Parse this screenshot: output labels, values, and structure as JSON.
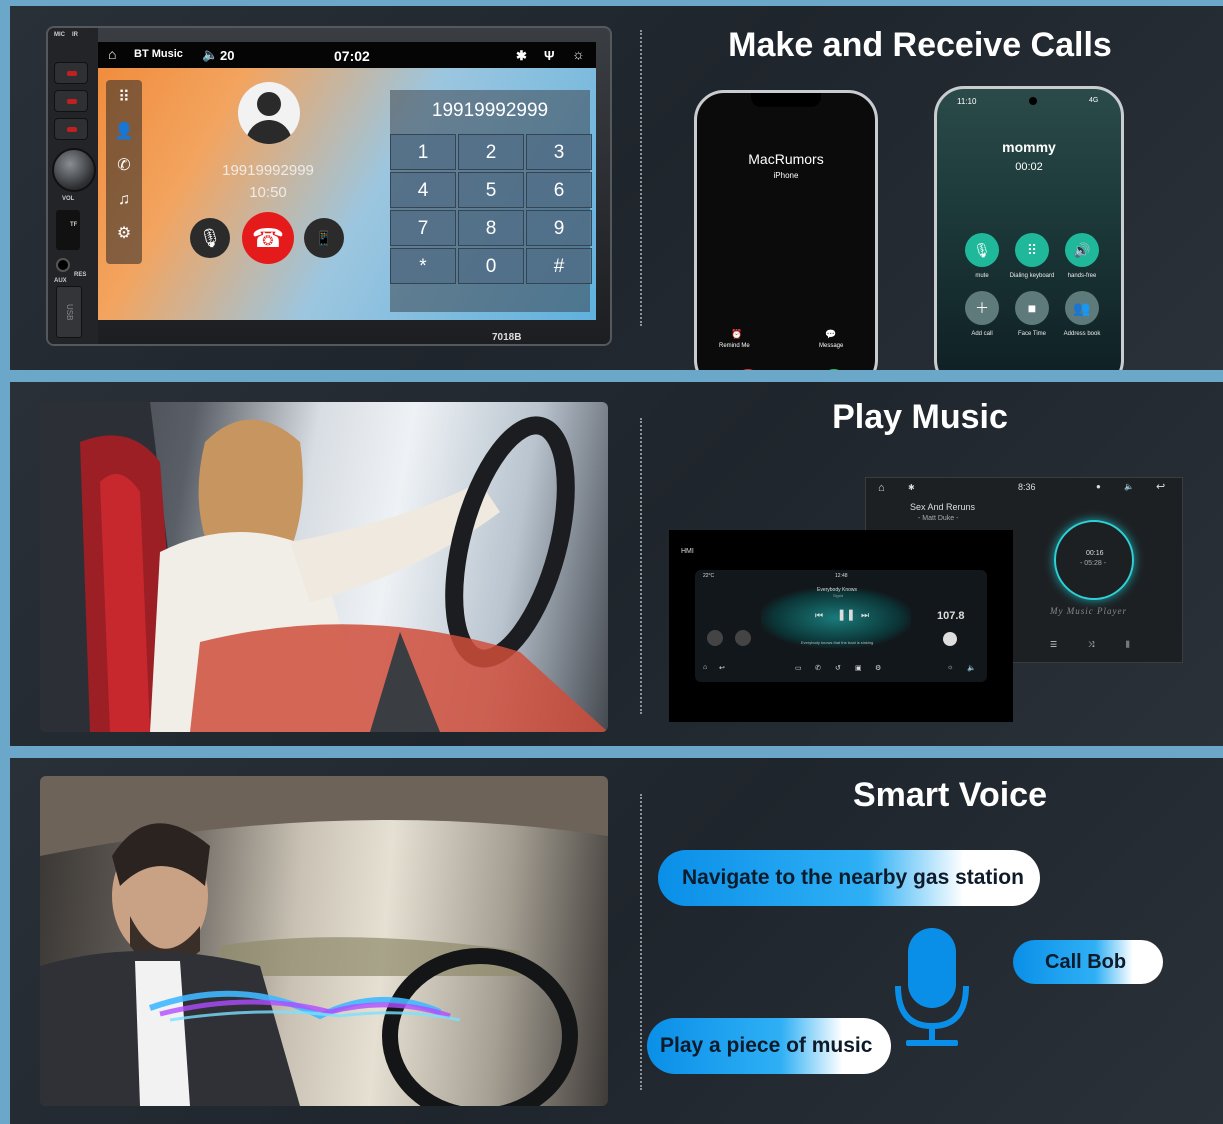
{
  "sections": {
    "calls": {
      "title": "Make and Receive Calls"
    },
    "music": {
      "title": "Play Music"
    },
    "voice": {
      "title": "Smart Voice"
    }
  },
  "head_unit": {
    "labels": {
      "mic": "MIC",
      "ir": "IR",
      "vol": "VOL",
      "tf": "TF",
      "res": "RES",
      "aux": "AUX",
      "usb": "USB"
    },
    "model": "7018B",
    "status": {
      "source": "BT Music",
      "volume": "20",
      "time": "07:02"
    },
    "call": {
      "number": "19919992999",
      "duration": "10:50"
    },
    "dialer": {
      "number": "19919992999",
      "keys": [
        "1",
        "2",
        "3",
        "4",
        "5",
        "6",
        "7",
        "8",
        "9",
        "*",
        "0",
        "#"
      ]
    }
  },
  "phone1": {
    "caller": "MacRumors",
    "sub": "iPhone",
    "remind": "Remind Me",
    "message": "Message"
  },
  "phone2": {
    "status_time": "11:10",
    "network": "4G",
    "caller": "mommy",
    "timer": "00:02",
    "buttons": [
      {
        "label": "mute",
        "icon": "mic-off-icon"
      },
      {
        "label": "Dialing keyboard",
        "icon": "keypad-icon"
      },
      {
        "label": "hands-free",
        "icon": "speaker-icon"
      },
      {
        "label": "Add call",
        "icon": "plus-icon"
      },
      {
        "label": "Face Time",
        "icon": "video-icon"
      },
      {
        "label": "Address book",
        "icon": "contacts-icon"
      }
    ]
  },
  "music_screen_back": {
    "time": "8:36",
    "song": "Sex And Reruns",
    "artist": "- Matt Duke -",
    "elapsed": "00:16",
    "total": "- 05:28 -",
    "player": "My Music Player"
  },
  "music_screen_front": {
    "hmi": "HMI",
    "temp": "22°C",
    "clock": "12:48",
    "song": "Everybody Knows",
    "artist": "Sigrid",
    "lyric": "Everybody knows that the boat is sinking",
    "fm": "107.8"
  },
  "voice": {
    "commands": [
      "Navigate to the nearby gas station",
      "Call Bob",
      "Play a piece of music"
    ]
  },
  "colors": {
    "accent_blue": "#0a8fe8",
    "end_call_red": "#e51b1b",
    "panel_dark": "#23292f",
    "border_blue": "#6aa7c9"
  }
}
